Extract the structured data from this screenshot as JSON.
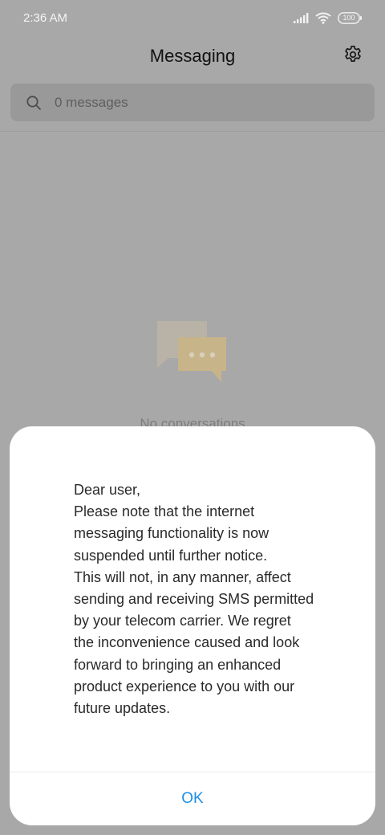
{
  "status_bar": {
    "time": "2:36 AM",
    "battery": "100",
    "icons": [
      "signal-icon",
      "wifi-icon",
      "battery-icon"
    ]
  },
  "header": {
    "title": "Messaging",
    "settings_icon": "gear-icon"
  },
  "search": {
    "placeholder": "0 messages",
    "icon": "search-icon"
  },
  "empty_state": {
    "icon": "chat-bubbles-icon",
    "text": "No conversations"
  },
  "dialog": {
    "greeting": "Dear user,",
    "lines": [
      "Please note that the internet",
      "messaging functionality is now",
      "suspended until further notice.",
      "This will not, in any manner, affect",
      "sending and receiving SMS permitted",
      "by your telecom carrier. We regret",
      "the inconvenience caused and look",
      "forward to bringing an enhanced",
      "product experience to you with our",
      "future updates."
    ],
    "ok_label": "OK"
  },
  "colors": {
    "accent": "#1e8fe6",
    "empty_icon_back": "#bdb7a8",
    "empty_icon_front": "#c9b58e",
    "scrim": "#a8a8a8"
  }
}
